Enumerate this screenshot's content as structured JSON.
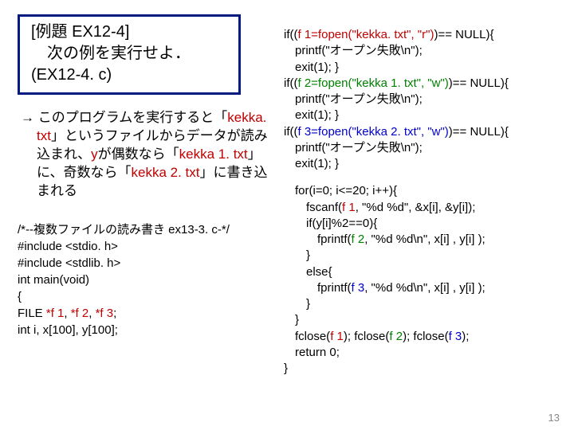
{
  "title": {
    "line1": "[例題 EX12-4]",
    "line2": "　次の例を実行せよ．",
    "line3": "(EX12-4. c)"
  },
  "desc": {
    "arrow": "→ ",
    "text1": "このプログラムを実行すると「",
    "kekka": "kekka. txt",
    "text2": "」というファイルからデータが読み込まれ、",
    "yvar": "y",
    "text3": "が偶数なら「",
    "kekka1": "kekka 1. txt",
    "text4": "」に、奇数なら「",
    "kekka2": "kekka 2. txt",
    "text5": "」に書き込まれる"
  },
  "codeLeft": {
    "l1": "/*--複数ファイルの読み書き ex13-3. c-*/",
    "l2": "#include <stdio. h>",
    "l3": "#include <stdlib. h>",
    "l4": "int main(void)",
    "l5": "{",
    "l6a": "   FILE ",
    "l6b": "*f 1",
    "l6c": ", ",
    "l6d": "*f 2",
    "l6e": ", ",
    "l6f": "*f 3",
    "l6g": ";",
    "l7": "   int i, x[100], y[100];"
  },
  "codeRight": {
    "r1a": "if((",
    "r1b": "f 1=fopen(\"kekka. txt\", \"r\")",
    "r1c": ")== NULL){",
    "r2": "printf(\"オープン失敗\\n\");",
    "r3": "exit(1); }",
    "r4a": "if((",
    "r4b": "f 2=fopen(\"kekka 1. txt\", \"w\")",
    "r4c": ")== NULL){",
    "r5": "printf(\"オープン失敗\\n\");",
    "r6": "exit(1); }",
    "r7a": "if((",
    "r7b": "f 3=fopen(\"kekka 2. txt\", \"w\")",
    "r7c": ")== NULL){",
    "r8": "printf(\"オープン失敗\\n\");",
    "r9": "exit(1); }",
    "r10": "for(i=0; i<=20; i++){",
    "r11a": "fscanf(",
    "r11b": "f 1",
    "r11c": ", \"%d %d\", &x[i], &y[i]);",
    "r12": "if(y[i]%2==0){",
    "r13a": "fprintf(",
    "r13b": "f 2",
    "r13c": ", \"%d  %d\\n\", x[i] , y[i] );",
    "r14": "}",
    "r15": "else{",
    "r16a": "fprintf(",
    "r16b": "f 3",
    "r16c": ", \"%d  %d\\n\", x[i] , y[i] );",
    "r17": "}",
    "r18": "}",
    "r19a": "fclose(",
    "r19b": "f 1",
    "r19c": "); fclose(",
    "r19d": "f 2",
    "r19e": "); fclose(",
    "r19f": "f 3",
    "r19g": ");",
    "r20": "return 0;",
    "r21": "}"
  },
  "pagenum": "13"
}
